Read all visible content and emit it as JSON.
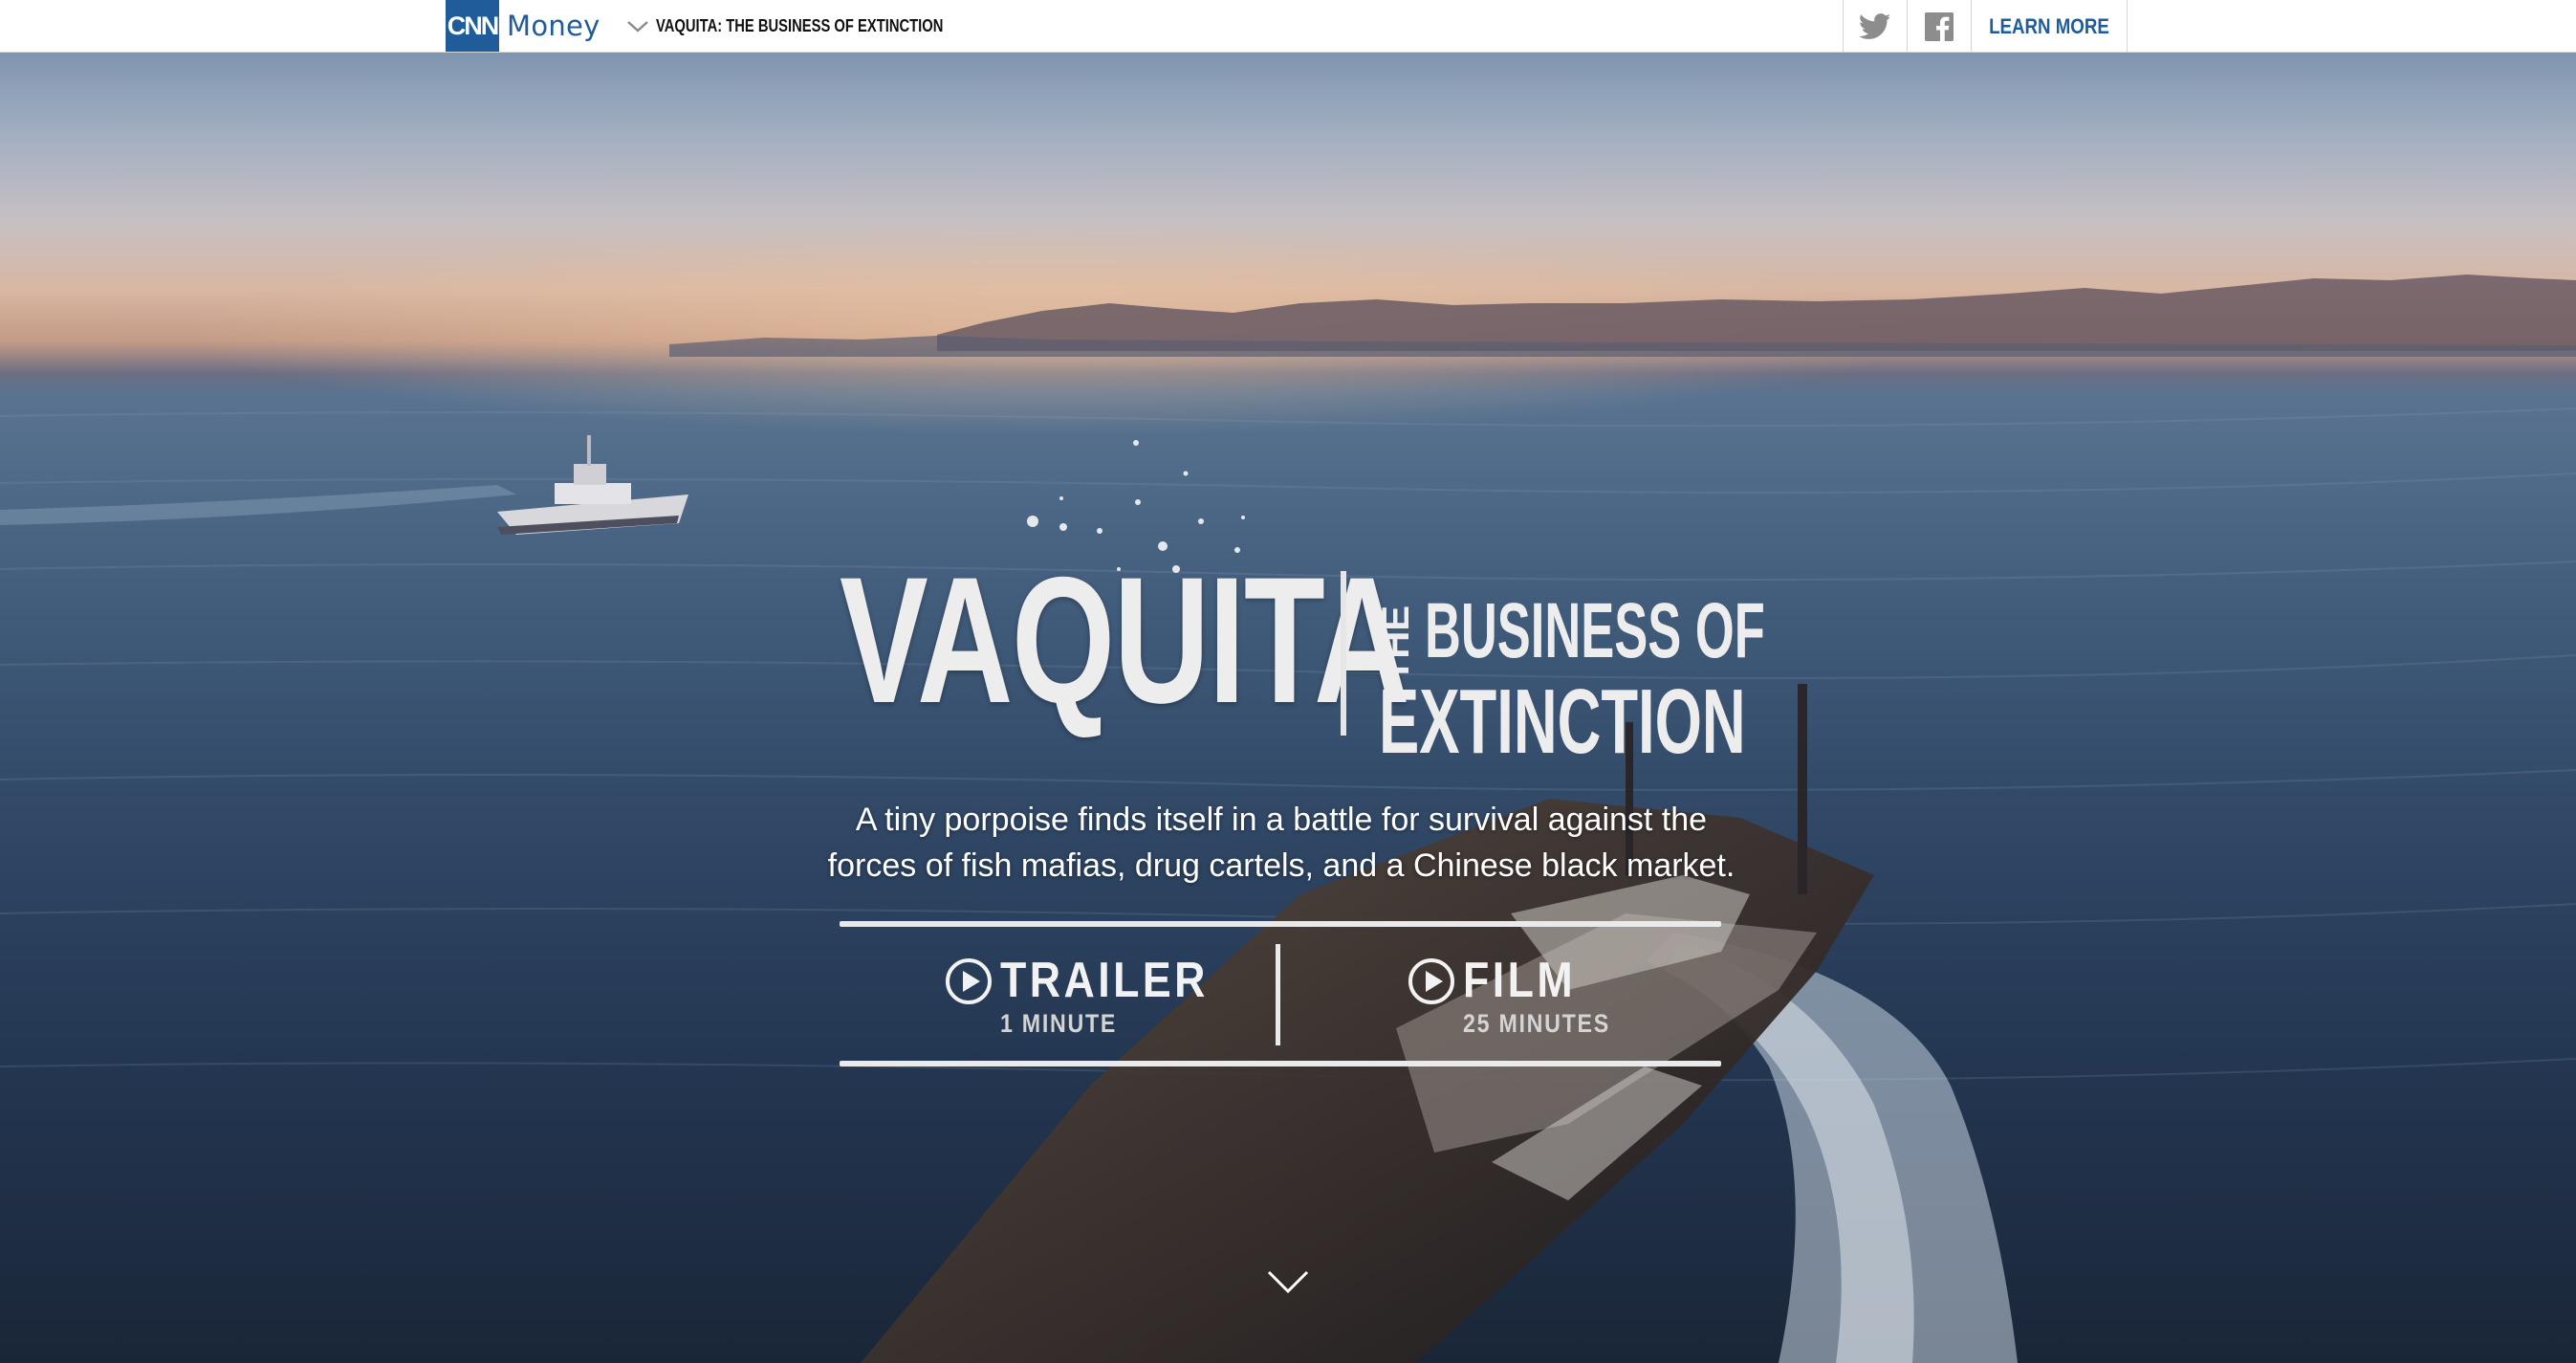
{
  "header": {
    "logo_brand": "CNN",
    "logo_section": "Money",
    "story_title": "VAQUITA: THE BUSINESS OF EXTINCTION",
    "learn_more_label": "LEARN MORE"
  },
  "icons": {
    "story_menu": "chevron-down-icon",
    "twitter": "twitter-icon",
    "facebook": "facebook-icon",
    "play": "play-icon",
    "scroll": "chevron-down-icon"
  },
  "hero": {
    "title_main": "VAQUITA",
    "title_the": "THE",
    "title_line1": "BUSINESS OF",
    "title_line2": "EXTINCTION",
    "tagline_line1": "A tiny porpoise finds itself in a battle for survival against the",
    "tagline_line2": "forces of fish mafias, drug cartels, and a Chinese black market."
  },
  "videos": [
    {
      "label": "TRAILER",
      "duration": "1 MINUTE"
    },
    {
      "label": "FILM",
      "duration": "25 MINUTES"
    }
  ],
  "colors": {
    "brand_blue": "#1f5c99",
    "topbar_bg": "#ffffff",
    "hero_text": "#ededed"
  }
}
